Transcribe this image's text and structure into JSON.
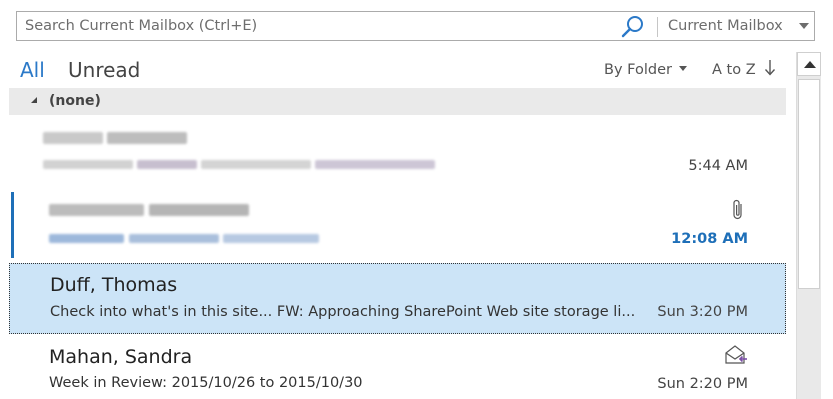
{
  "search": {
    "placeholder": "Search Current Mailbox (Ctrl+E)",
    "scope": "Current Mailbox",
    "search_icon": "search-icon"
  },
  "filter": {
    "all": "All",
    "unread": "Unread",
    "arrange_by": "By Folder",
    "sort_order": "A to Z",
    "sort_icon": "arrow-down-icon"
  },
  "group": {
    "label": "(none)"
  },
  "messages": [
    {
      "sender": "",
      "subject": "",
      "time": "5:44 AM",
      "redacted": true,
      "unread": false
    },
    {
      "sender": "",
      "subject": "",
      "time": "12:08 AM",
      "redacted": true,
      "unread": true,
      "icon": "paperclip-icon"
    },
    {
      "sender": "Duff, Thomas",
      "subject": "Check into what's in this site... FW: Approaching SharePoint Web site storage li...",
      "time": "Sun 3:20 PM",
      "selected": true
    },
    {
      "sender": "Mahan, Sandra",
      "subject": "Week in Review: 2015/10/26 to 2015/10/30",
      "time": "Sun 2:20 PM",
      "icon": "envelope-reply-icon"
    }
  ],
  "colors": {
    "accent": "#2b79c8",
    "selected": "#cce4f7",
    "unread": "#1e6fb8"
  }
}
